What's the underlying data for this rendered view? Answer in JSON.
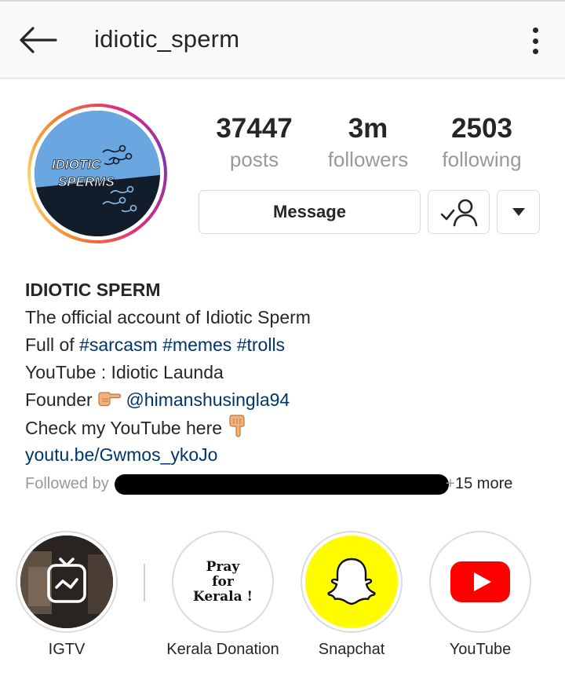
{
  "header": {
    "username": "idiotic_sperm"
  },
  "avatar": {
    "logo_line1": "IDIOTIC",
    "logo_line2": "SPERMS"
  },
  "stats": [
    {
      "value": "37447",
      "label": "posts"
    },
    {
      "value": "3m",
      "label": "followers"
    },
    {
      "value": "2503",
      "label": "following"
    }
  ],
  "actions": {
    "message_label": "Message"
  },
  "bio": {
    "name": "IDIOTIC SPERM",
    "line1": "The official account of Idiotic Sperm",
    "line2_prefix": "Full of ",
    "line2_tags": "#sarcasm #memes #trolls",
    "line3": "YouTube : Idiotic Launda",
    "line4_prefix": "Founder",
    "line4_mention": "@himanshusingla94",
    "line5": "Check my YouTube here",
    "link": "youtu.be/Gwmos_ykoJo"
  },
  "followed_by": {
    "prefix": "Followed by",
    "plus": "+",
    "more": "15 more"
  },
  "highlights": [
    {
      "label": "IGTV",
      "icon": "igtv-icon"
    },
    {
      "label": "Kerala Donation",
      "icon": "pray-for-kerala-sticker",
      "text_lines": [
        "Pray",
        "for",
        "Kerala !"
      ]
    },
    {
      "label": "Snapchat",
      "icon": "snapchat-ghost-icon"
    },
    {
      "label": "YouTube",
      "icon": "youtube-play-icon"
    }
  ],
  "colors": {
    "link": "#003569",
    "muted": "#999999",
    "snapchat": "#fffc00",
    "youtube": "#ff0000"
  }
}
